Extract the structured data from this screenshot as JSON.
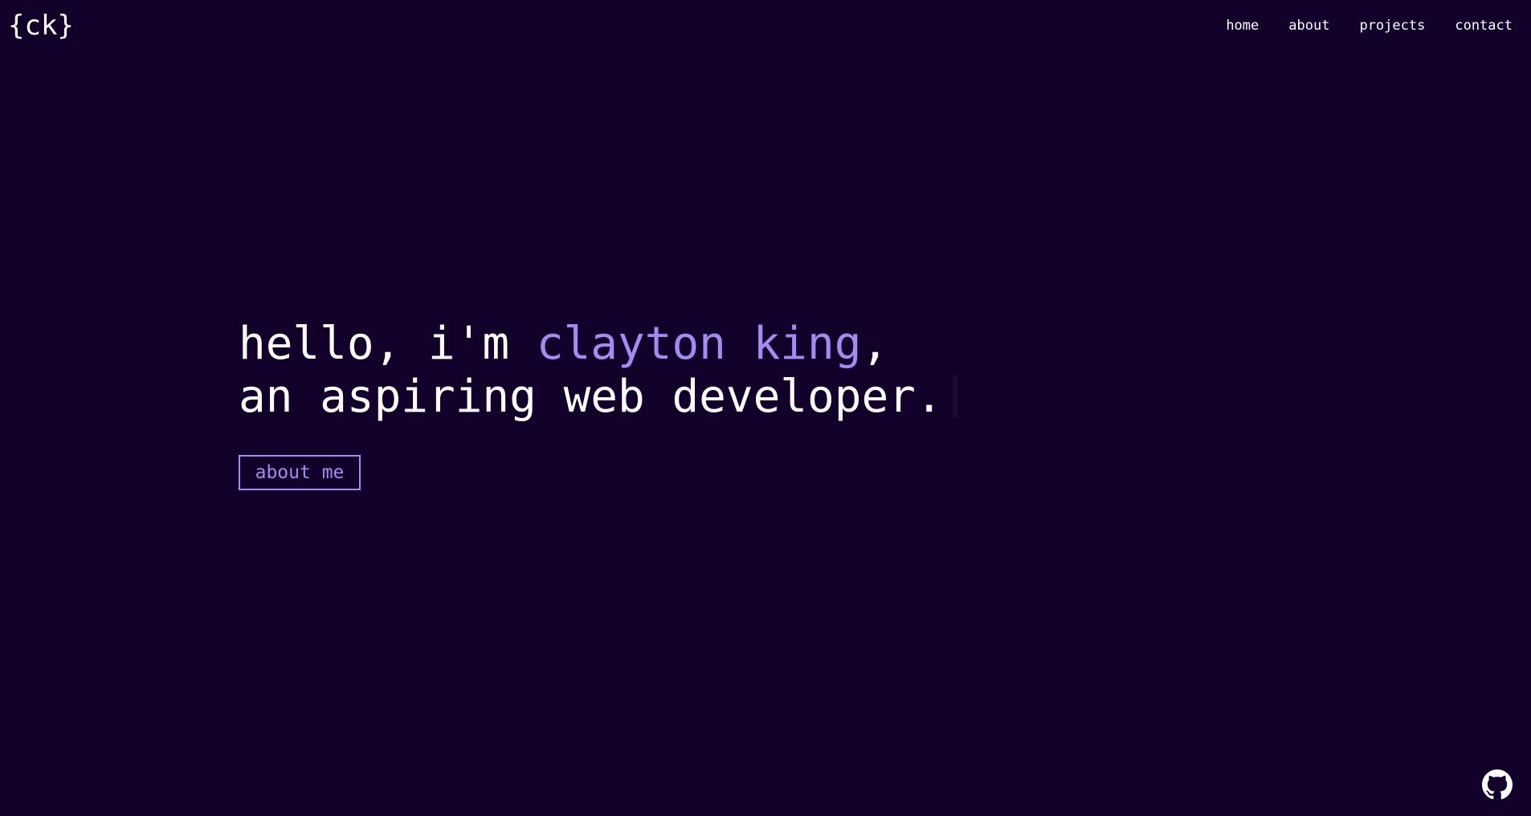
{
  "header": {
    "logo_text": "{ck}",
    "nav": [
      {
        "label": "home"
      },
      {
        "label": "about"
      },
      {
        "label": "projects"
      },
      {
        "label": "contact"
      }
    ]
  },
  "hero": {
    "line1_prefix": "hello, i'm ",
    "line1_name": "clayton king",
    "line1_suffix": ",",
    "line2": "an aspiring web developer.",
    "cta_label": "about me"
  },
  "footer": {
    "github_icon": "github-icon"
  },
  "colors": {
    "background": "#12002a",
    "text": "#ffffff",
    "accent": "#a58af2"
  }
}
